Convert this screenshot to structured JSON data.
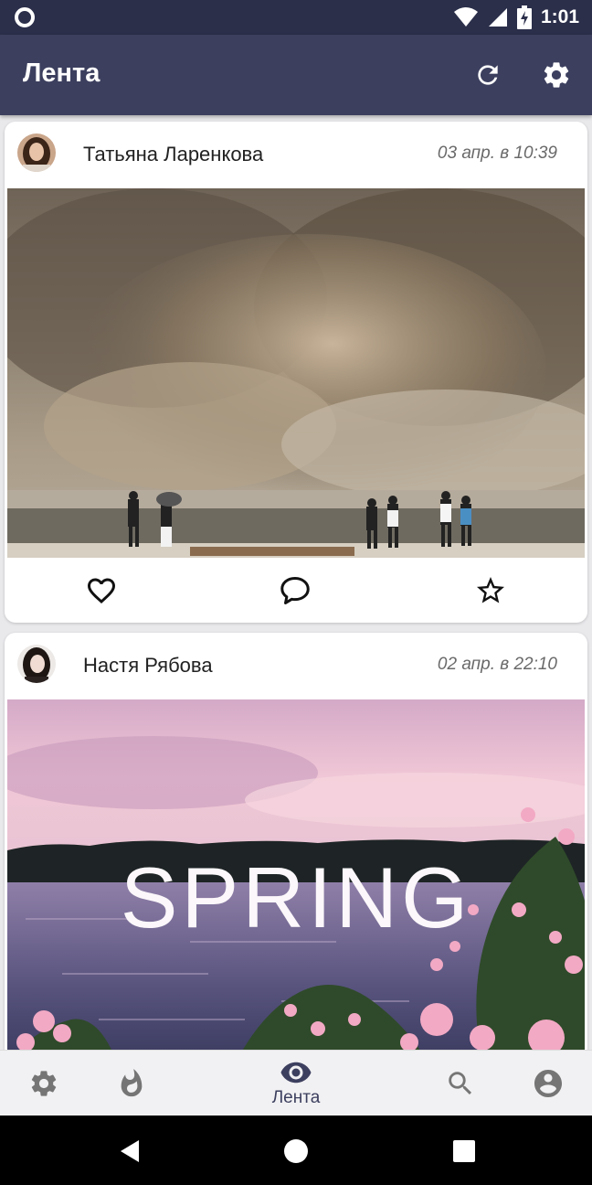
{
  "status_bar": {
    "time": "1:01"
  },
  "app_bar": {
    "title": "Лента",
    "icons": [
      "refresh-icon",
      "settings-gear-icon"
    ]
  },
  "feed": {
    "posts": [
      {
        "author": "Татьяна Ларенкова",
        "date": "03 апр. в 10:39",
        "image": "flood-spillway-photo",
        "actions": [
          "heart-icon",
          "comment-icon",
          "star-icon"
        ]
      },
      {
        "author": "Настя Рябова",
        "date": "02 апр. в 22:10",
        "image": "spring-lake-photo",
        "image_text": "SPRING"
      }
    ]
  },
  "bottom_nav": {
    "items": [
      {
        "icon": "settings-icon"
      },
      {
        "icon": "fire-icon"
      },
      {
        "icon": "eye-icon",
        "label": "Лента",
        "active": true
      },
      {
        "icon": "search-icon"
      },
      {
        "icon": "account-icon"
      }
    ]
  },
  "colors": {
    "status_bar": "#2b2f4a",
    "app_bar": "#3c3f5e",
    "background": "#e9e9ec",
    "nav_active": "#3c3f5e",
    "nav_inactive": "#757575"
  }
}
